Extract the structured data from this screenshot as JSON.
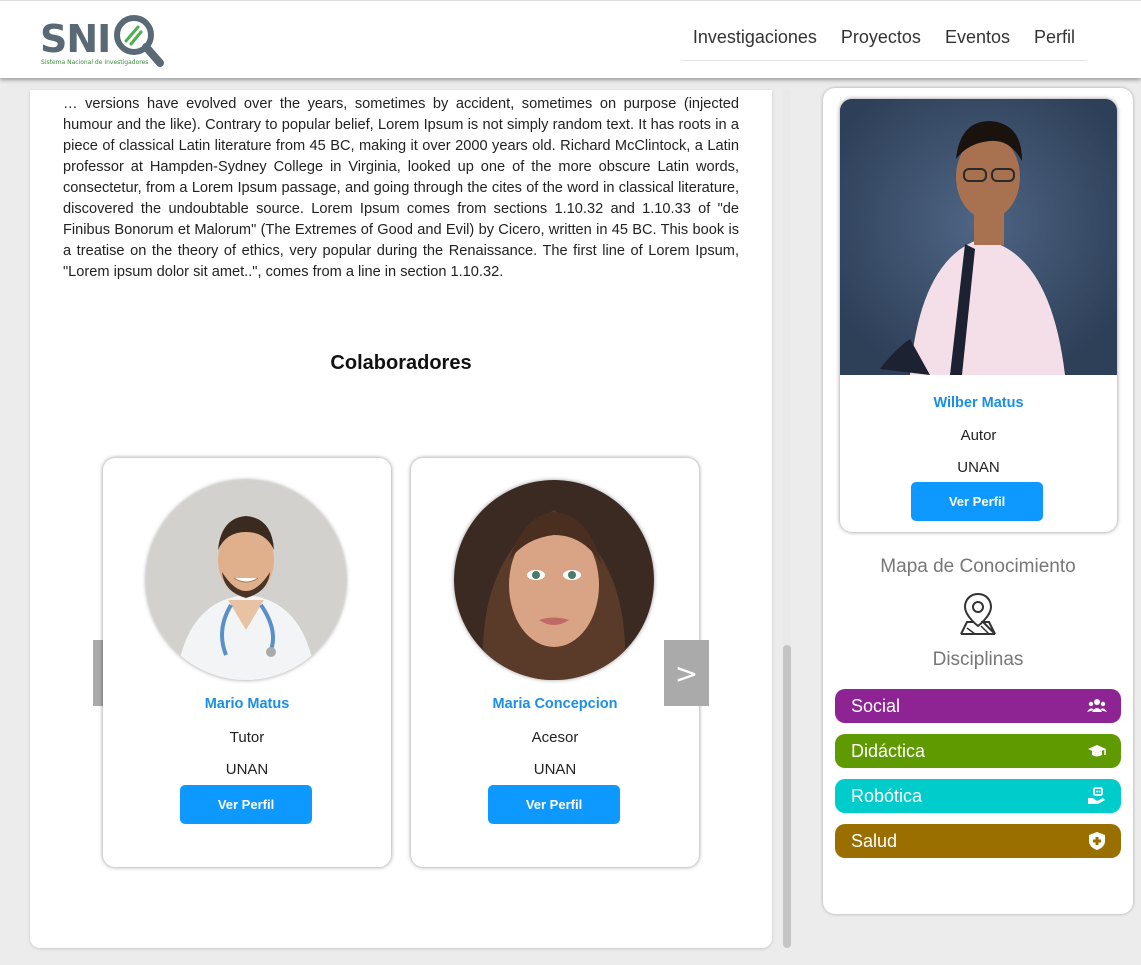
{
  "header": {
    "logo_text": "SNI",
    "logo_subtitle": "Sistema Nacional de Investigadores",
    "nav": [
      {
        "label": "Investigaciones"
      },
      {
        "label": "Proyectos"
      },
      {
        "label": "Eventos"
      },
      {
        "label": "Perfil"
      }
    ]
  },
  "article": {
    "text": "… versions have evolved over the years, sometimes by accident, sometimes on purpose (injected humour and the like). Contrary to popular belief, Lorem Ipsum is not simply random text. It has roots in a piece of classical Latin literature from 45 BC, making it over 2000 years old. Richard McClintock, a Latin professor at Hampden-Sydney College in Virginia, looked up one of the more obscure Latin words, consectetur, from a Lorem Ipsum passage, and going through the cites of the word in classical literature, discovered the undoubtable source. Lorem Ipsum comes from sections 1.10.32 and 1.10.33 of \"de Finibus Bonorum et Malorum\" (The Extremes of Good and Evil) by Cicero, written in 45 BC. This book is a treatise on the theory of ethics, very popular during the Renaissance. The first line of Lorem Ipsum, \"Lorem ipsum dolor sit amet..\", comes from a line in section 1.10.32."
  },
  "collaborators": {
    "title": "Colaboradores",
    "prev_label": "<",
    "next_label": ">",
    "cards": [
      {
        "name": "Mario Matus",
        "role": "Tutor",
        "institution": "UNAN",
        "button": "Ver Perfil"
      },
      {
        "name": "Maria Concepcion",
        "role": "Acesor",
        "institution": "UNAN",
        "button": "Ver Perfil"
      }
    ]
  },
  "author": {
    "name": "Wilber Matus",
    "role": "Autor",
    "institution": "UNAN",
    "button": "Ver Perfil"
  },
  "sidebar": {
    "map_title": "Mapa de Conocimiento",
    "disciplines_title": "Disciplinas",
    "disciplines": [
      {
        "label": "Social",
        "color": "#8e2393",
        "icon": "users-icon"
      },
      {
        "label": "Didáctica",
        "color": "#5f9a00",
        "icon": "graduation-cap-icon"
      },
      {
        "label": "Robótica",
        "color": "#00cccc",
        "icon": "robot-hand-icon"
      },
      {
        "label": "Salud",
        "color": "#9a6f00",
        "icon": "shield-plus-icon"
      }
    ]
  },
  "colors": {
    "accent_blue": "#0d99ff",
    "name_blue": "#1a8fe6",
    "logo_gray": "#596a76"
  }
}
